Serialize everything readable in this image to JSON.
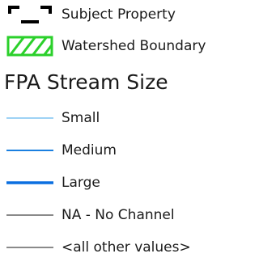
{
  "legend": {
    "polygons": [
      {
        "label": "Subject Property",
        "icon": "subject-property-bracket-icon",
        "color": "#000000"
      },
      {
        "label": "Watershed Boundary",
        "icon": "hatched-green-box-icon",
        "color": "#2bd02b"
      }
    ],
    "heading": "FPA Stream Size",
    "lines": [
      {
        "label": "Small",
        "color": "#7ec3f2",
        "weight": "thin"
      },
      {
        "label": "Medium",
        "color": "#1a7fe0",
        "weight": "medium"
      },
      {
        "label": "Large",
        "color": "#0a6fe0",
        "weight": "thick"
      },
      {
        "label": "NA - No Channel",
        "color": "#8a8a8a",
        "weight": "medium"
      },
      {
        "label": "<all other values>",
        "color": "#8a8a8a",
        "weight": "medium"
      }
    ]
  }
}
